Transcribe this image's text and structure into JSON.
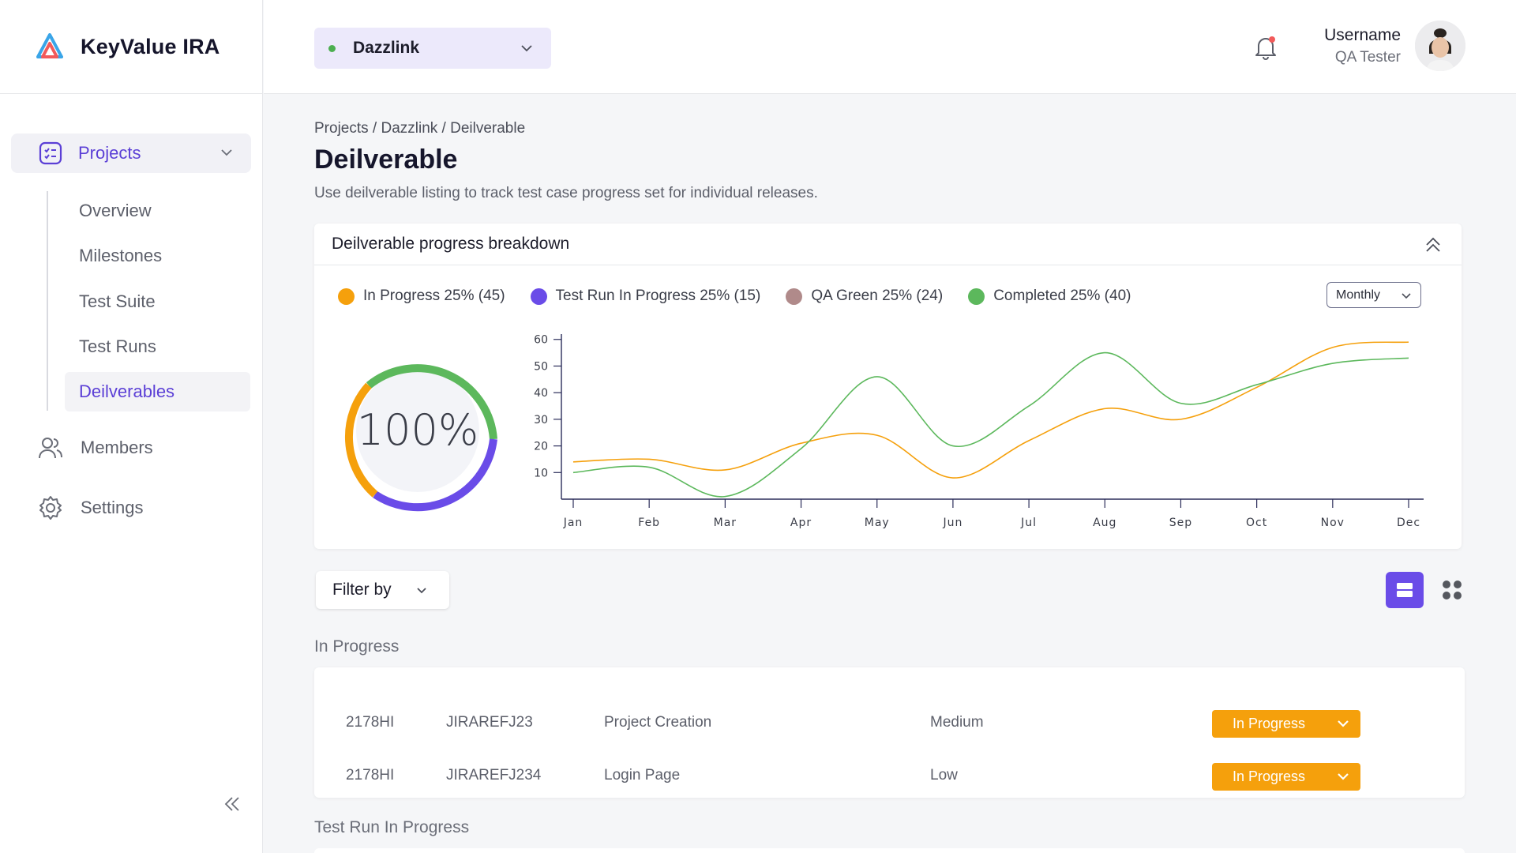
{
  "brand": {
    "name": "KeyValue IRA"
  },
  "sidebar": {
    "projects_label": "Projects",
    "sub_items": [
      {
        "label": "Overview"
      },
      {
        "label": "Milestones"
      },
      {
        "label": "Test Suite"
      },
      {
        "label": "Test Runs"
      },
      {
        "label": "Deilverables",
        "active": true
      }
    ],
    "members_label": "Members",
    "settings_label": "Settings"
  },
  "topbar": {
    "project_name": "Dazzlink",
    "user_name": "Username",
    "user_role": "QA Tester"
  },
  "page": {
    "breadcrumb": "Projects / Dazzlink / Deilverable",
    "title": "Deilverable",
    "description": "Use deilverable listing to track test case progress set for individual releases."
  },
  "progress_card": {
    "title": "Deilverable progress breakdown",
    "legend": [
      {
        "label": "In Progress  25% (45)",
        "color": "#f5a00c"
      },
      {
        "label": "Test Run In Progress 25% (15)",
        "color": "#6a4ce8"
      },
      {
        "label": "QA Green 25% (24)",
        "color": "#b08a8a"
      },
      {
        "label": "Completed 25% (40)",
        "color": "#5cb85c"
      }
    ],
    "period": "Monthly",
    "donut_label": "100%"
  },
  "chart_data": {
    "type": "line",
    "x": [
      "Jan",
      "Feb",
      "Mar",
      "Apr",
      "May",
      "Jun",
      "Jul",
      "Aug",
      "Sep",
      "Oct",
      "Nov",
      "Dec"
    ],
    "yticks": [
      10,
      20,
      30,
      40,
      50,
      60
    ],
    "ylim": [
      0,
      62
    ],
    "series": [
      {
        "color": "#f5a00c",
        "values": [
          14,
          15,
          11,
          21,
          24,
          8,
          22,
          34,
          30,
          42,
          57,
          59
        ]
      },
      {
        "color": "#5cb85c",
        "values": [
          10,
          12,
          1,
          19,
          46,
          20,
          35,
          55,
          36,
          43,
          51,
          53
        ]
      }
    ]
  },
  "controls": {
    "filter_label": "Filter by"
  },
  "sections": [
    {
      "title": "In Progress",
      "rows": [
        {
          "id": "2178HI",
          "ref": "JIRAREFJ23",
          "name": "Project Creation",
          "priority": "Medium",
          "status": "In Progress"
        },
        {
          "id": "2178HI",
          "ref": "JIRAREFJ234",
          "name": "Login Page",
          "priority": "Low",
          "status": "In Progress"
        }
      ]
    },
    {
      "title": "Test Run In Progress"
    }
  ]
}
